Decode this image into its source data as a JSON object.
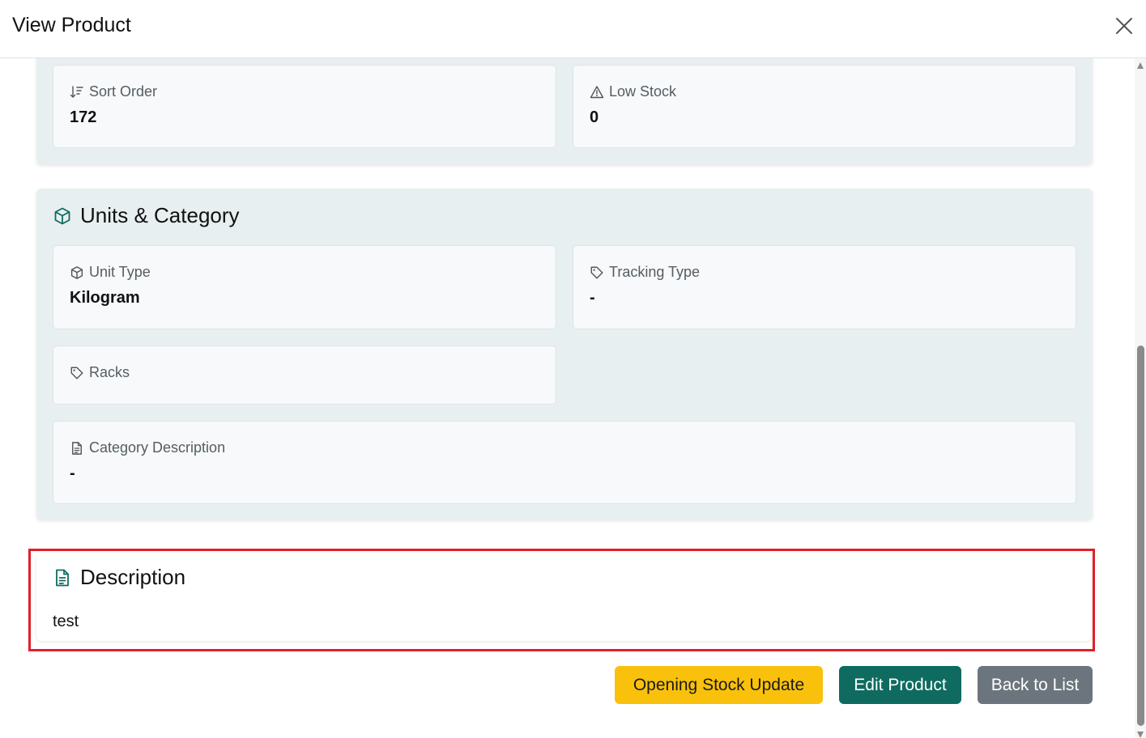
{
  "modal": {
    "title": "View Product"
  },
  "inventory": {
    "sort_order": {
      "label": "Sort Order",
      "value": "172"
    },
    "low_stock": {
      "label": "Low Stock",
      "value": "0"
    }
  },
  "units_category": {
    "title": "Units & Category",
    "unit_type": {
      "label": "Unit Type",
      "value": "Kilogram"
    },
    "tracking_type": {
      "label": "Tracking Type",
      "value": "-"
    },
    "racks": {
      "label": "Racks",
      "value": ""
    },
    "category_description": {
      "label": "Category Description",
      "value": "-"
    }
  },
  "description": {
    "title": "Description",
    "text": "test"
  },
  "actions": {
    "opening_stock_label": "Opening Stock Update",
    "edit_label": "Edit Product",
    "back_label": "Back to List"
  },
  "colors": {
    "accent": "#0f6b60",
    "warning": "#f9c10c",
    "secondary": "#6c757d",
    "highlight": "#e0202b"
  }
}
